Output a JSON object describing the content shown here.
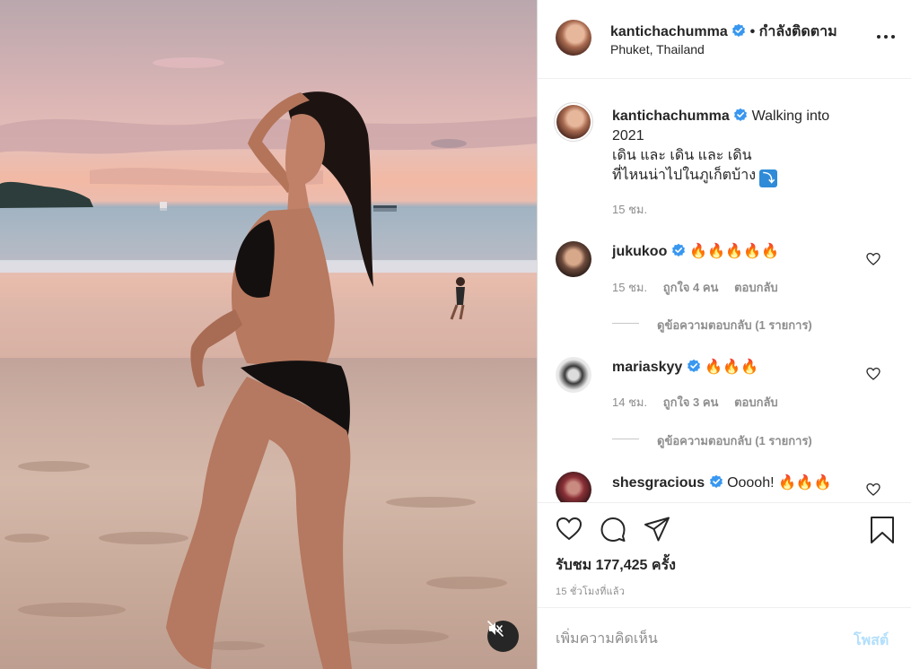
{
  "post": {
    "author": "kantichachumma",
    "follow_label": "• กำลังติดตาม",
    "location": "Phuket, Thailand"
  },
  "caption": {
    "username": "kantichachumma",
    "line1": "Walking into",
    "line2": "2021",
    "line3": "เดิน และ เดิน และ เดิน",
    "line4": "ที่ไหนน่าไปในภูเก็ตบ้าง",
    "badge": "⤵",
    "time": "15 ชม."
  },
  "comments": [
    {
      "username": "jukukoo",
      "text": "🔥🔥🔥🔥🔥",
      "time": "15 ชม.",
      "likes": "ถูกใจ 4 คน",
      "reply": "ตอบกลับ",
      "view_replies": "ดูข้อความตอบกลับ (1 รายการ)"
    },
    {
      "username": "mariaskyy",
      "text": "🔥🔥🔥",
      "time": "14 ชม.",
      "likes": "ถูกใจ 3 คน",
      "reply": "ตอบกลับ",
      "view_replies": "ดูข้อความตอบกลับ (1 รายการ)"
    },
    {
      "username": "shesgracious",
      "text": "Ooooh! 🔥🔥🔥"
    }
  ],
  "stats": {
    "views": "รับชม 177,425 ครั้ง",
    "time_ago": "15 ชั่วโมงที่แล้ว"
  },
  "composer": {
    "placeholder": "เพิ่มความคิดเห็น",
    "post_label": "โพสต์"
  },
  "icons": {
    "verified": "verified-badge-icon",
    "more": "more-options-icon",
    "like": "heart-icon",
    "comment": "comment-bubble-icon",
    "share": "paper-plane-icon",
    "save": "bookmark-icon",
    "mute": "speaker-muted-icon"
  },
  "colors": {
    "verified": "#3897f0",
    "post_disabled": "#b2dffc",
    "secondary_text": "#8e8e8e"
  }
}
